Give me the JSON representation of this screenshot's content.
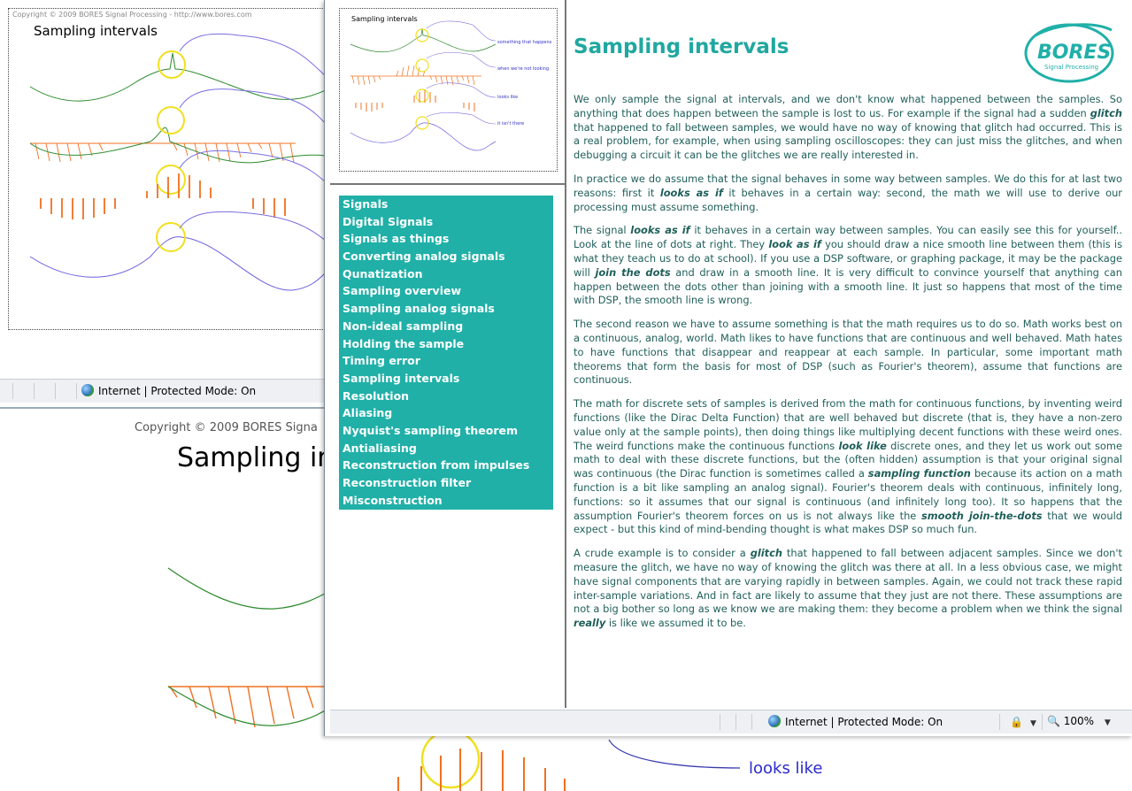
{
  "background": {
    "copyright": "Copyright © 2009 BORES Signa",
    "title": "Sampling in",
    "annotation": "looks like"
  },
  "back_window": {
    "figure": {
      "copyright": "Copyright © 2009 BORES Signal Processing - http://www.bores.com",
      "title": "Sampling intervals"
    },
    "status": {
      "zone": "Internet | Protected Mode: On"
    }
  },
  "front_window": {
    "thumbnail": {
      "title": "Sampling intervals",
      "notes": [
        "something that happens",
        "when we're not looking",
        "looks like",
        "it isn't there"
      ]
    },
    "nav": [
      "Signals",
      "Digital Signals",
      "Signals as things",
      "Converting analog signals",
      "Qunatization",
      "Sampling overview",
      "Sampling analog signals",
      "Non-ideal sampling",
      "Holding the sample",
      "Timing error",
      "Sampling intervals",
      "Resolution",
      "Aliasing",
      "Nyquist's sampling theorem",
      "Antialiasing",
      "Reconstruction from impulses",
      "Reconstruction filter",
      "Misconstruction"
    ],
    "content": {
      "title": "Sampling intervals",
      "logo": {
        "name": "BORES",
        "tagline": "Signal Processing"
      },
      "paragraphs": [
        "We only sample the signal at intervals, and we don't know what happened between the samples. So anything that does happen between the sample is lost to us. For example if the signal had a sudden <b>glitch</b> that happened to fall between samples, we would have no way of knowing that glitch had occurred. This is a real problem, for example, when using sampling oscilloscopes: they can just miss the glitches, and when debugging a circuit it can be the glitches we are really interested in.",
        "In practice we do assume that the signal behaves in some way between samples. We do this for at last two reasons: first it <b>looks as if</b> it behaves in a certain way: second, the math we will use to derive our processing must assume something.",
        "The signal <b>looks as if</b> it behaves in a certain way between samples. You can easily see this for yourself.. Look at the line of dots at right. They <b>look as if</b> you should draw a nice smooth line between them (this is what they teach us to do at school). If you use a DSP software, or graphing package, it may be the package will <b>join the dots</b> and draw in a smooth line. It is very difficult to convince yourself that anything can happen between the dots other than joining with a smooth line. It just so happens that most of the time with DSP, the smooth line is wrong.",
        "The second reason we have to assume something is that the math requires us to do so. Math works best on a continuous, analog, world. Math likes to have functions that are continuous and well behaved. Math hates to have functions that disappear and reappear at each sample. In particular, some important math theorems that form the basis for most of DSP (such as Fourier's theorem), assume that functions are continuous.",
        "The math for discrete sets of samples is derived from the math for continuous functions, by inventing weird functions (like the Dirac Delta Function) that are well behaved but discrete (that is, they have a non-zero value only at the sample points), then doing things like multiplying decent functions with these weird ones. The weird functions make the continuous functions <b>look like</b> discrete ones, and they let us work out some math to deal with these discrete functions, but the (often hidden) assumption is that your original signal was continuous (the Dirac function is sometimes called a <b>sampling function</b> because its action on a math function is a bit like sampling an analog signal). Fourier's theorem deals with continuous, infinitely long, functions: so it assumes that our signal is continuous (and infinitely long too). It so happens that the assumption Fourier's theorem forces on us is not always like the <b>smooth join-the-dots</b> that we would expect - but this kind of mind-bending thought is what makes DSP so much fun.",
        "A crude example is to consider a <b>glitch</b> that happened to fall between adjacent samples. Since we don't measure the glitch, we have no way of knowing the glitch was there at all. In a less obvious case, we might have signal components that are varying rapidly in between samples. Again, we could not track these rapid inter-sample variations. And in fact are likely to assume that they just are not there. These assumptions are not a big bother so long as we know we are making them: they become a problem when we think the signal <b>really</b> is like we assumed it to be."
      ]
    },
    "status": {
      "zone": "Internet | Protected Mode: On",
      "zoom": "100%"
    }
  }
}
